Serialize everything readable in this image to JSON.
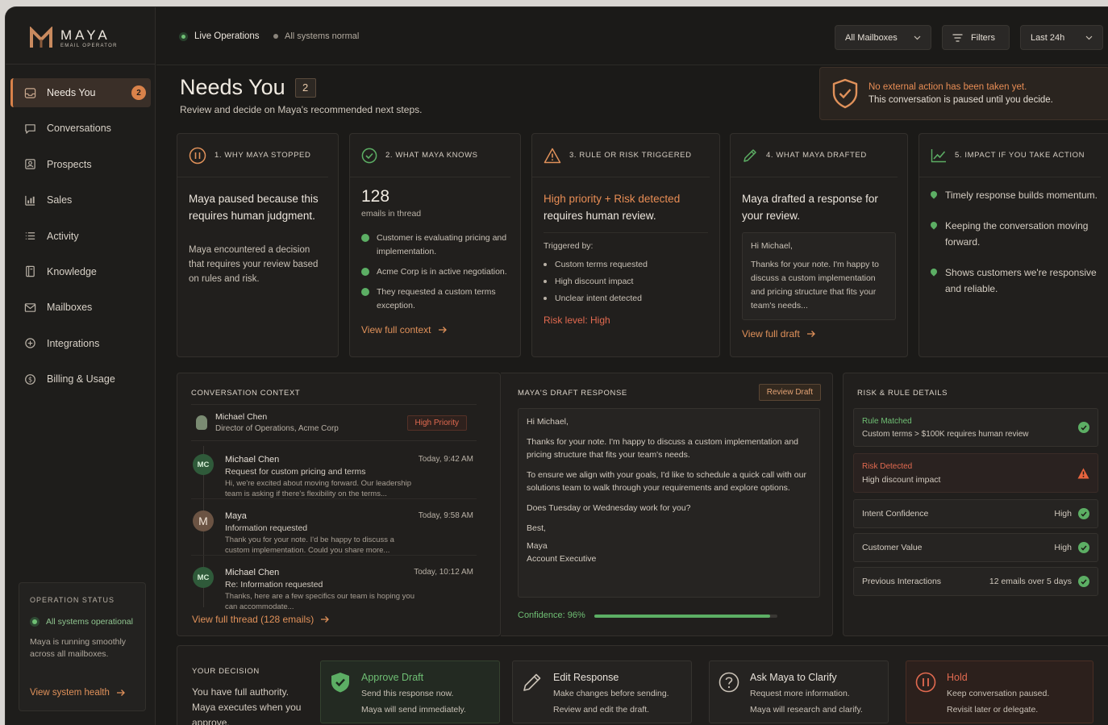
{
  "brand": {
    "name": "MAYA",
    "subtitle": "EMAIL OPERATOR"
  },
  "sidebar": {
    "items": [
      {
        "label": "Needs You",
        "badge": "2",
        "icon": "inbox-icon",
        "active": true
      },
      {
        "label": "Conversations",
        "icon": "chat-bubble-icon"
      },
      {
        "label": "Prospects",
        "icon": "contact-card-icon"
      },
      {
        "label": "Sales",
        "icon": "bar-chart-icon"
      },
      {
        "label": "Activity",
        "icon": "list-icon"
      },
      {
        "label": "Knowledge",
        "icon": "book-icon"
      },
      {
        "label": "Mailboxes",
        "icon": "mail-icon"
      },
      {
        "label": "Integrations",
        "icon": "puzzle-icon"
      },
      {
        "label": "Billing & Usage",
        "icon": "dollar-coin-icon"
      }
    ],
    "operation_status": {
      "title": "OPERATION STATUS",
      "status": "All systems operational",
      "description": "Maya is running smoothly across all mailboxes.",
      "link": "View system health"
    }
  },
  "topbar": {
    "live": "Live Operations",
    "systems": "All systems normal",
    "mailbox_select": "All Mailboxes",
    "filters": "Filters",
    "range_select": "Last 24h"
  },
  "header": {
    "title": "Needs You",
    "count": "2",
    "subtitle": "Review and decide on Maya's recommended next steps.",
    "notice_line1": "No external action has been taken yet.",
    "notice_line2": "This conversation is paused until you decide."
  },
  "cards": {
    "why": {
      "label": "1. WHY MAYA STOPPED",
      "headline": "Maya paused because this requires human judgment.",
      "body": "Maya encountered a decision that requires your review based on rules and risk."
    },
    "knows": {
      "label": "2. WHAT MAYA KNOWS",
      "count": "128",
      "count_label": "emails in thread",
      "facts": [
        "Customer is evaluating pricing and implementation.",
        "Acme Corp is in active negotiation.",
        "They requested a custom terms exception."
      ],
      "link": "View full context"
    },
    "rule": {
      "label": "3. RULE OR RISK TRIGGERED",
      "highlight": "High priority + Risk detected",
      "headline_rest": "requires human review.",
      "triggered_by": "Triggered by:",
      "triggers": [
        "Custom terms requested",
        "High discount impact",
        "Unclear intent detected"
      ],
      "risk_level": "Risk level: High"
    },
    "drafted": {
      "label": "4. WHAT MAYA DRAFTED",
      "headline": "Maya drafted a response for your review.",
      "greeting": "Hi Michael,",
      "excerpt": "Thanks for your note. I'm happy to discuss a custom implementation and pricing structure that fits your team's needs...",
      "link": "View full draft"
    },
    "impact": {
      "label": "5. IMPACT IF YOU TAKE ACTION",
      "items": [
        "Timely response builds momentum.",
        "Keeping the conversation moving forward.",
        "Shows customers we're responsive and reliable."
      ]
    }
  },
  "context": {
    "title": "CONVERSATION CONTEXT",
    "contact_name": "Michael Chen",
    "contact_role": "Director of Operations, Acme Corp",
    "priority": "High Priority",
    "messages": [
      {
        "initials": "MC",
        "name": "Michael Chen",
        "time": "Today, 9:42 AM",
        "subject": "Request for custom pricing and terms",
        "preview": "Hi, we're excited about moving forward. Our leadership team is asking if there's flexibility on the terms..."
      },
      {
        "initials": "M",
        "name": "Maya",
        "time": "Today, 9:58 AM",
        "subject": "Information requested",
        "preview": "Thank you for your note. I'd be happy to discuss a custom implementation. Could you share more..."
      },
      {
        "initials": "MC",
        "name": "Michael Chen",
        "time": "Today, 10:12 AM",
        "subject": "Re: Information requested",
        "preview": "Thanks, here are a few specifics our team is hoping you can accommodate..."
      }
    ],
    "link": "View full thread (128 emails)"
  },
  "draft": {
    "title": "MAYA'S DRAFT RESPONSE",
    "review_button": "Review Draft",
    "greeting": "Hi Michael,",
    "p1": "Thanks for your note. I'm happy to discuss a custom implementation and pricing structure that fits your team's needs.",
    "p2": "To ensure we align with your goals, I'd like to schedule a quick call with our solutions team to walk through your requirements and explore options.",
    "p3": "Does Tuesday or Wednesday work for you?",
    "signoff": "Best,",
    "sig_name": "Maya",
    "sig_title": "Account Executive",
    "confidence_label": "Confidence: 96%",
    "confidence": 0.96
  },
  "risk": {
    "title": "RISK & RULE DETAILS",
    "rule_matched_label": "Rule Matched",
    "rule_matched_text": "Custom terms > $100K requires human review",
    "risk_detected_label": "Risk Detected",
    "risk_detected_text": "High discount impact",
    "rows": [
      {
        "key": "Intent Confidence",
        "value": "High"
      },
      {
        "key": "Customer Value",
        "value": "High"
      },
      {
        "key": "Previous Interactions",
        "value": "12 emails over 5 days"
      }
    ]
  },
  "decision": {
    "title": "YOUR DECISION",
    "description": "You have full authority. Maya executes when you approve.",
    "options": [
      {
        "title": "Approve Draft",
        "line1": "Send this response now.",
        "line2": "Maya will send immediately.",
        "icon": "shield-check-icon"
      },
      {
        "title": "Edit Response",
        "line1": "Make changes before sending.",
        "line2": "Review and edit the draft.",
        "icon": "pencil-icon"
      },
      {
        "title": "Ask Maya to Clarify",
        "line1": "Request more information.",
        "line2": "Maya will research and clarify.",
        "icon": "question-icon"
      },
      {
        "title": "Hold",
        "line1": "Keep conversation paused.",
        "line2": "Revisit later or delegate.",
        "icon": "pause-icon"
      }
    ]
  },
  "colors": {
    "accent": "#e0915a",
    "success": "#5cae64",
    "danger": "#e26a50",
    "background": "#1b1a18"
  }
}
